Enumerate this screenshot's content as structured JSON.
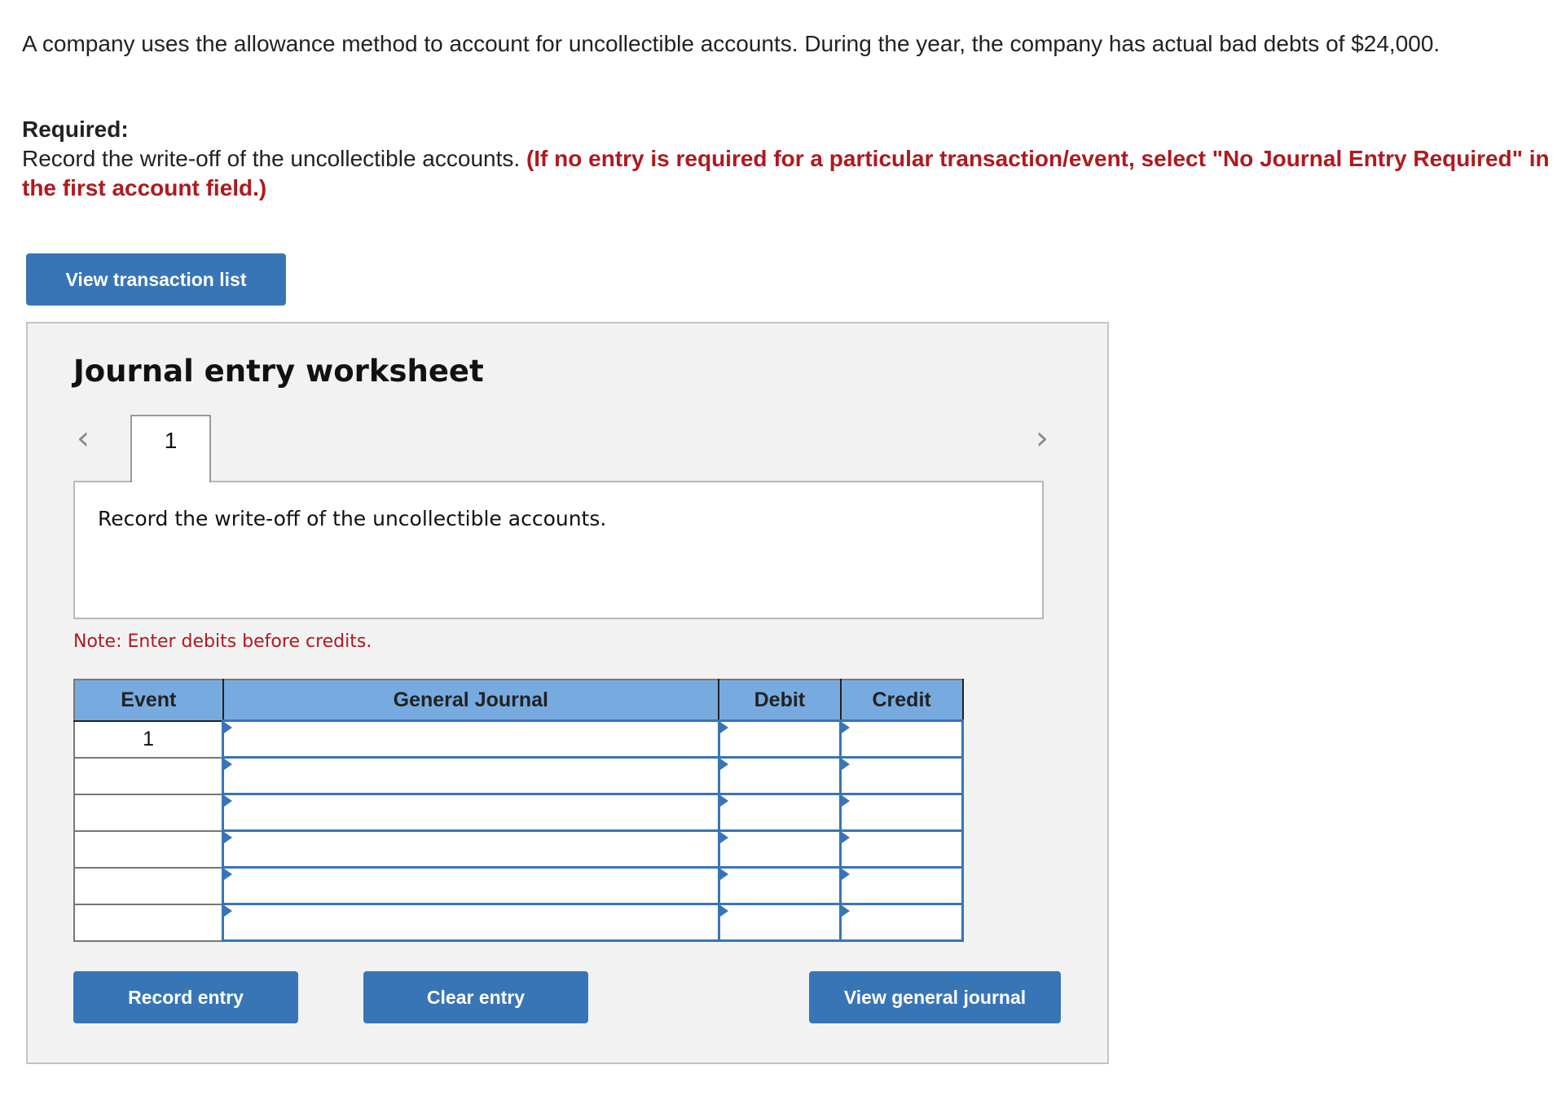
{
  "question": {
    "intro": "A company uses the allowance method to account for uncollectible accounts. During the year, the company has actual bad debts of $24,000.",
    "required_label": "Required:",
    "required_text": "Record the write-off of the uncollectible accounts.",
    "required_instruction": "(If no entry is required for a particular transaction/event, select \"No Journal Entry Required\" in the first account field.)"
  },
  "buttons": {
    "view_transaction_list": "View transaction list",
    "record_entry": "Record entry",
    "clear_entry": "Clear entry",
    "view_general_journal": "View general journal"
  },
  "worksheet": {
    "title": "Journal entry worksheet",
    "prev_icon": "chevron-left-icon",
    "next_icon": "chevron-right-icon",
    "tabs": [
      {
        "label": "1"
      }
    ],
    "description": "Record the write-off of the uncollectible accounts.",
    "note": "Note: Enter debits before credits."
  },
  "journal_table": {
    "headers": [
      "Event",
      "General Journal",
      "Debit",
      "Credit"
    ],
    "rows": [
      {
        "event": "1",
        "account": "",
        "debit": "",
        "credit": ""
      },
      {
        "event": "",
        "account": "",
        "debit": "",
        "credit": ""
      },
      {
        "event": "",
        "account": "",
        "debit": "",
        "credit": ""
      },
      {
        "event": "",
        "account": "",
        "debit": "",
        "credit": ""
      },
      {
        "event": "",
        "account": "",
        "debit": "",
        "credit": ""
      },
      {
        "event": "",
        "account": "",
        "debit": "",
        "credit": ""
      }
    ]
  },
  "colors": {
    "button_blue": "#3875b7",
    "header_blue": "#77abe0",
    "instruction_red": "#b0191e",
    "panel_bg": "#f2f2f2"
  }
}
